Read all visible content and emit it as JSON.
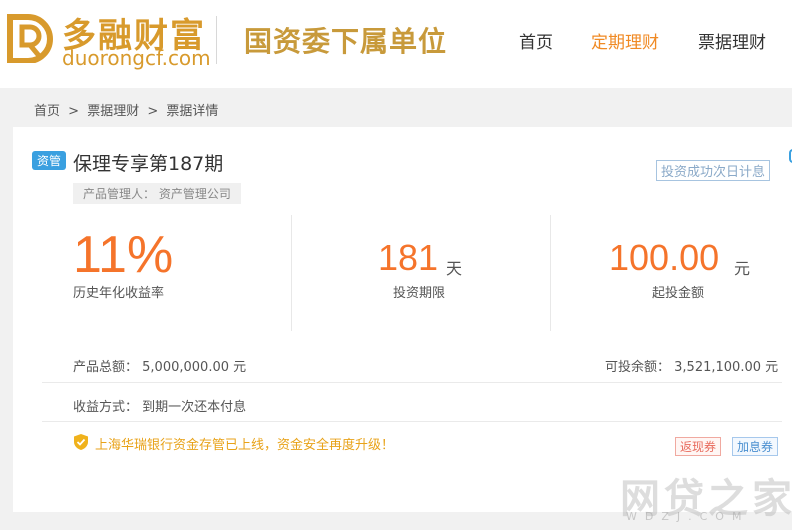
{
  "header": {
    "logo_cn": "多融财富",
    "logo_en": "duorongcf.com",
    "slogan": "国资委下属单位",
    "nav": [
      {
        "label": "首页",
        "active": false
      },
      {
        "label": "定期理财",
        "active": true
      },
      {
        "label": "票据理财",
        "active": false
      }
    ]
  },
  "breadcrumb": {
    "items": [
      "首页",
      "票据理财",
      "票据详情"
    ],
    "separator": ">"
  },
  "product": {
    "tag": "资管",
    "title": "保理专享第187期",
    "manager": "产品管理人： 资产管理公司",
    "notice": "投资成功次日计息",
    "rate": "11%",
    "rate_label": "历史年化收益率",
    "term_value": "181",
    "term_unit": "天",
    "term_label": "投资期限",
    "min_value": "100.00",
    "min_unit": "元",
    "min_label": "起投金额",
    "total_label": "产品总额：",
    "total_value": "5,000,000.00 元",
    "remain_label": "可投余额：",
    "remain_value": "3,521,100.00 元",
    "repay_label": "收益方式：",
    "repay_value": "到期一次还本付息",
    "security_text": "上海华瑞银行资金存管已上线，资金安全再度升级！",
    "coupon_red": "返现券",
    "coupon_blue": "加息券"
  },
  "watermark": {
    "main": "网贷之家",
    "sub": "WDZJ.COM"
  },
  "colors": {
    "brand_gold": "#d89a2c",
    "accent_orange": "#f5742b",
    "nav_active": "#f08a24",
    "tag_blue": "#3aa0e0"
  },
  "icons": [
    "logo-mark-icon",
    "shield-icon"
  ]
}
